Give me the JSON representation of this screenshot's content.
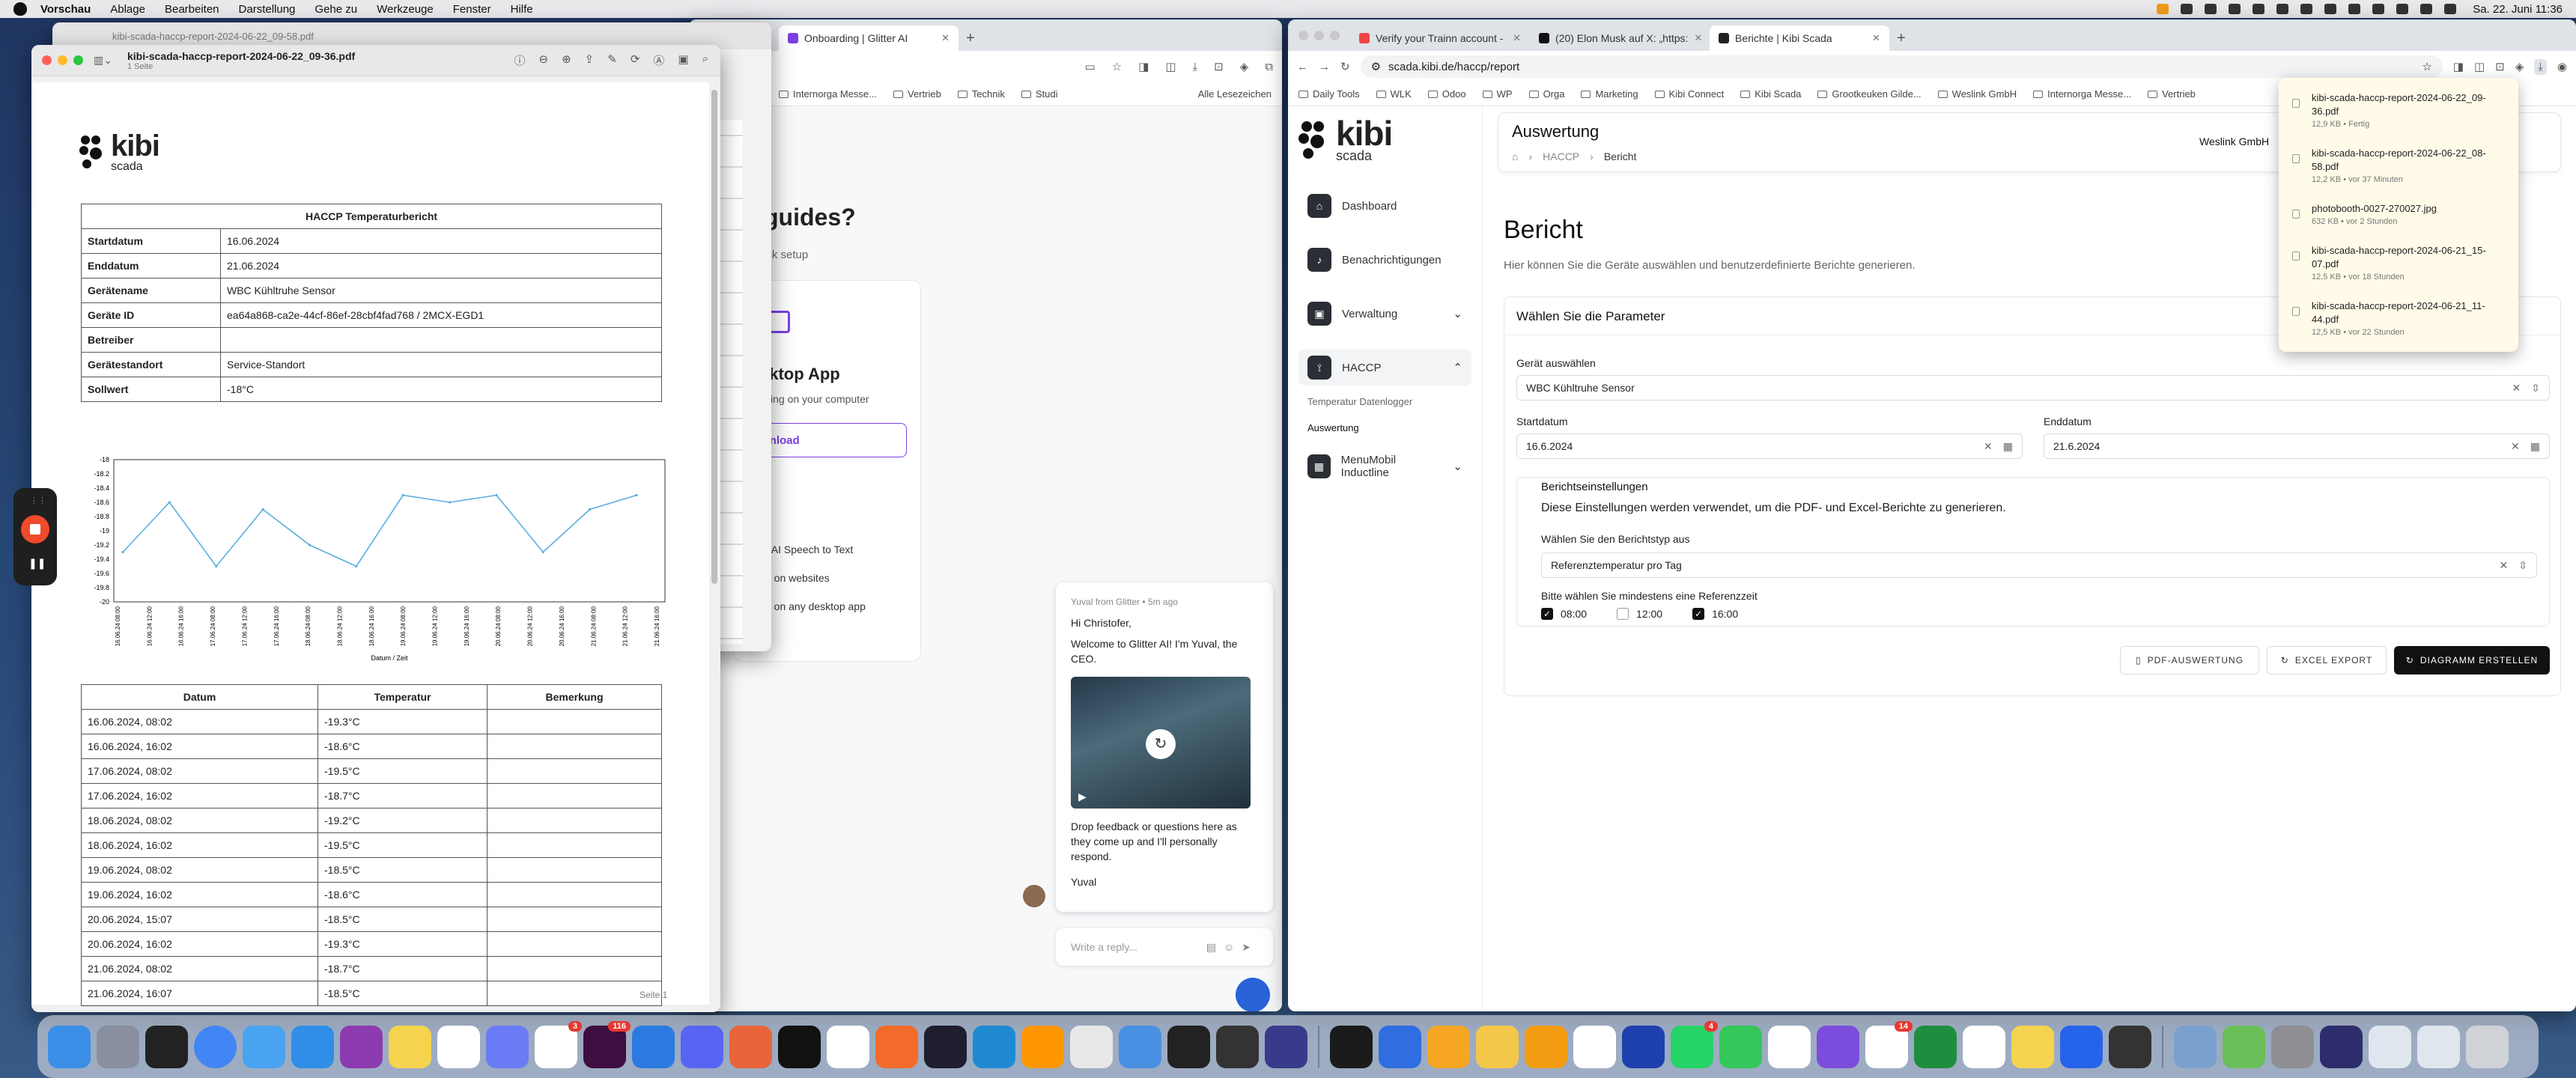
{
  "menubar": {
    "items": [
      "Vorschau",
      "Ablage",
      "Bearbeiten",
      "Darstellung",
      "Gehe zu",
      "Werkzeuge",
      "Fenster",
      "Hilfe"
    ],
    "clock": "Sa. 22. Juni 11:36"
  },
  "middle_browser": {
    "tabs": [
      {
        "title": "Onboarding | Glitter AI"
      }
    ],
    "page": {
      "heading": "guides?",
      "sub": "ick setup",
      "desktop_title": "sktop App",
      "desktop_sub": "ssing on your computer",
      "download_label": "wnload",
      "bullets": [
        "e: AI Speech to Text",
        "es on websites",
        "es on any desktop app"
      ]
    },
    "chat": {
      "sender": "Yuval from Glitter",
      "time": "5m ago",
      "greeting": "Hi Christofer,",
      "welcome": "Welcome to Glitter AI! I'm Yuval, the CEO.",
      "feedback": "Drop feedback or questions here as they come up and I'll personally respond.",
      "signature": "Yuval",
      "reply_placeholder": "Write a reply..."
    }
  },
  "right_browser": {
    "tabs": [
      {
        "title": "Verify your Trainn account -"
      },
      {
        "title": "(20) Elon Musk auf X: „https:"
      },
      {
        "title": "Berichte | Kibi Scada"
      }
    ],
    "url": "scada.kibi.de/haccp/report",
    "bookmarks": [
      "Daily Tools",
      "WLK",
      "Odoo",
      "WP",
      "Orga",
      "Marketing",
      "Kibi Connect",
      "Kibi Scada",
      "Grootkeuken Gilde...",
      "Weslink GmbH",
      "Internorga Messe...",
      "Vertrieb",
      "Alle Lesezeichen"
    ]
  },
  "scada": {
    "logo": "kibi",
    "logo_sub": "scada",
    "nav": [
      {
        "label": "Dashboard"
      },
      {
        "label": "Benachrichtigungen"
      },
      {
        "label": "Verwaltung"
      },
      {
        "label": "HACCP"
      },
      {
        "label": "MenuMobil Inductline"
      }
    ],
    "sub_nav": [
      "Temperatur Datenlogger",
      "Auswertung"
    ],
    "header_title": "Auswertung",
    "breadcrumb": [
      "HACCP",
      "Bericht"
    ],
    "company": "Weslink GmbH",
    "page_title": "Bericht",
    "page_desc": "Hier können Sie die Geräte auswählen und benutzerdefinierte Berichte generieren.",
    "params_title": "Wählen Sie die Parameter",
    "device_label": "Gerät auswählen",
    "device_value": "WBC Kühltruhe Sensor",
    "start_label": "Startdatum",
    "start_value": "16.6.2024",
    "end_label": "Enddatum",
    "end_value": "21.6.2024",
    "settings_title": "Berichtseinstellungen",
    "settings_desc": "Diese Einstellungen werden verwendet, um die PDF- und Excel-Berichte zu generieren.",
    "type_label": "Wählen Sie den Berichtstyp aus",
    "type_value": "Referenztemperatur pro Tag",
    "ref_label": "Bitte wählen Sie mindestens eine Referenzzeit",
    "ref_times": [
      {
        "label": "08:00",
        "checked": true
      },
      {
        "label": "12:00",
        "checked": false
      },
      {
        "label": "16:00",
        "checked": true
      }
    ],
    "btn_pdf": "PDF-AUSWERTUNG",
    "btn_excel": "EXCEL EXPORT",
    "btn_chart": "DIAGRAMM ERSTELLEN"
  },
  "downloads": [
    {
      "name": "kibi-scada-haccp-report-2024-06-22_09-36.pdf",
      "meta": "12,9 KB • Fertig"
    },
    {
      "name": "kibi-scada-haccp-report-2024-06-22_08-58.pdf",
      "meta": "12,2 KB • vor 37 Minuten"
    },
    {
      "name": "photobooth-0027-270027.jpg",
      "meta": "632 KB • vor 2 Stunden"
    },
    {
      "name": "kibi-scada-haccp-report-2024-06-21_15-07.pdf",
      "meta": "12,5 KB • vor 18 Stunden"
    },
    {
      "name": "kibi-scada-haccp-report-2024-06-21_11-44.pdf",
      "meta": "12,5 KB • vor 22 Stunden"
    }
  ],
  "preview": {
    "bg_title": "kibi-scada-haccp-report-2024-06-22_09-58.pdf",
    "title": "kibi-scada-haccp-report-2024-06-22_09-36.pdf",
    "subtitle": "1 Seite",
    "page_label": "Seite 1"
  },
  "report": {
    "logo": "kibi",
    "logo_sub": "scada",
    "title": "HACCP Temperaturbericht",
    "info": [
      {
        "key": "Startdatum",
        "value": "16.06.2024"
      },
      {
        "key": "Enddatum",
        "value": "21.06.2024"
      },
      {
        "key": "Gerätename",
        "value": "WBC Kühltruhe Sensor"
      },
      {
        "key": "Geräte ID",
        "value": "ea64a868-ca2e-44cf-86ef-28cbf4fad768 / 2MCX-EGD1"
      },
      {
        "key": "Betreiber",
        "value": ""
      },
      {
        "key": "Gerätestandort",
        "value": "Service-Standort"
      },
      {
        "key": "Sollwert",
        "value": "-18°C"
      }
    ],
    "headers": [
      "Datum",
      "Temperatur",
      "Bemerkung"
    ],
    "rows": [
      [
        "16.06.2024, 08:02",
        "-19.3°C",
        ""
      ],
      [
        "16.06.2024, 16:02",
        "-18.6°C",
        ""
      ],
      [
        "17.06.2024, 08:02",
        "-19.5°C",
        ""
      ],
      [
        "17.06.2024, 16:02",
        "-18.7°C",
        ""
      ],
      [
        "18.06.2024, 08:02",
        "-19.2°C",
        ""
      ],
      [
        "18.06.2024, 16:02",
        "-19.5°C",
        ""
      ],
      [
        "19.06.2024, 08:02",
        "-18.5°C",
        ""
      ],
      [
        "19.06.2024, 16:02",
        "-18.6°C",
        ""
      ],
      [
        "20.06.2024, 15:07",
        "-18.5°C",
        ""
      ],
      [
        "20.06.2024, 16:02",
        "-19.3°C",
        ""
      ],
      [
        "21.06.2024, 08:02",
        "-18.7°C",
        ""
      ],
      [
        "21.06.2024, 16:07",
        "-18.5°C",
        ""
      ]
    ]
  },
  "chart_data": {
    "type": "line",
    "xlabel": "Datum / Zeit",
    "x": [
      "16.06.24 08:00",
      "16.06.24 12:00",
      "16.06.24 16:00",
      "17.06.24 08:00",
      "17.06.24 12:00",
      "17.06.24 16:00",
      "18.06.24 08:00",
      "18.06.24 12:00",
      "18.06.24 16:00",
      "19.06.24 08:00",
      "19.06.24 12:00",
      "19.06.24 16:00",
      "20.06.24 08:00",
      "20.06.24 12:00",
      "20.06.24 16:00",
      "21.06.24 08:00",
      "21.06.24 12:00",
      "21.06.24 16:00"
    ],
    "values": [
      -19.3,
      -18.6,
      -19.5,
      -18.7,
      -19.2,
      -19.5,
      -18.5,
      -18.6,
      -18.5,
      -19.3,
      -18.7,
      -18.5
    ],
    "yticks": [
      -18,
      -18.2,
      -18.4,
      -18.6,
      -18.8,
      -19,
      -19.2,
      -19.4,
      -19.6,
      -19.8,
      -20
    ],
    "ylim": [
      -20,
      -18
    ],
    "color": "#5aaee0"
  },
  "dock": {
    "badges": [
      "3",
      "116",
      "4",
      "14"
    ]
  }
}
